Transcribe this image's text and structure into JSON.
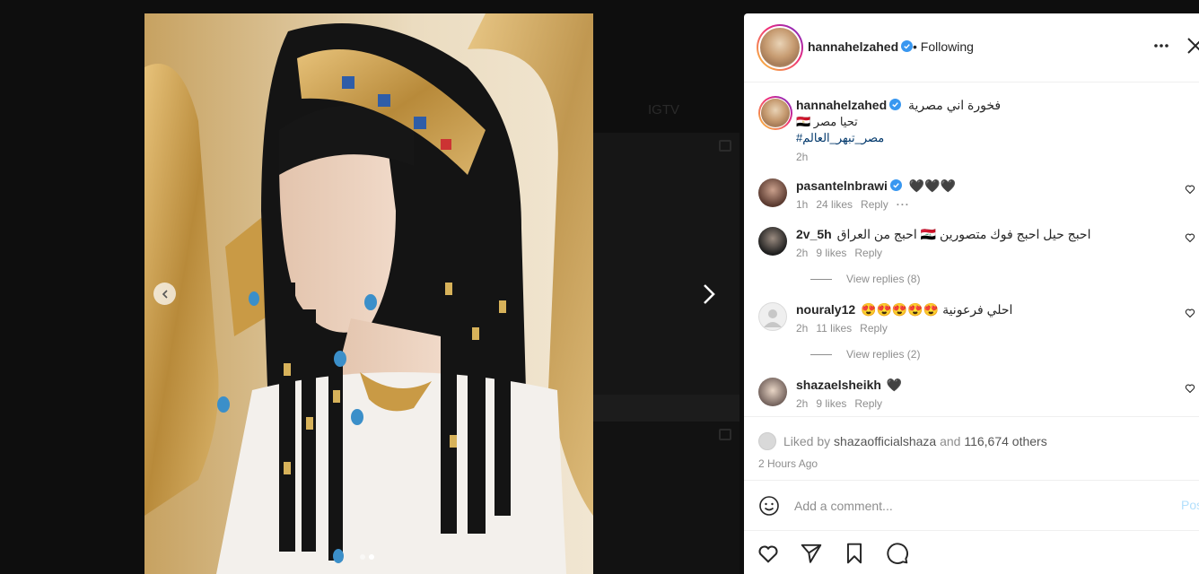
{
  "background": {
    "label": "IGTV"
  },
  "carousel": {
    "active_index": 1,
    "count": 2
  },
  "header": {
    "username": "hannahelzahed",
    "follow_status": "• Following"
  },
  "caption": {
    "username": "hannahelzahed",
    "text_line1": "فخورة اني مصرية",
    "text_line2": "تحيا مصر 🇪🇬",
    "hashtag": "#مصر_تبهر_العالم",
    "time": "2h"
  },
  "comments": [
    {
      "username": "pasantelnbrawi",
      "verified": true,
      "text": "🖤🖤🖤",
      "time": "1h",
      "likes": "24 likes",
      "reply": "Reply",
      "more": "···"
    },
    {
      "username": "2v_5h",
      "verified": false,
      "text": "احبج حيل احبج فوك متصورين 🇮🇶 احبج من العراق",
      "time": "2h",
      "likes": "9 likes",
      "reply": "Reply",
      "view_replies": "View replies (8)"
    },
    {
      "username": "nouraly12",
      "verified": false,
      "text": "احلي فرعونية 😍😍😍😍😍",
      "time": "2h",
      "likes": "11 likes",
      "reply": "Reply",
      "view_replies": "View replies (2)"
    },
    {
      "username": "shazaelsheikh",
      "verified": false,
      "text": "🖤",
      "time": "2h",
      "likes": "9 likes",
      "reply": "Reply"
    }
  ],
  "likes": {
    "prefix": "Liked by",
    "user": "shazaofficialshaza",
    "joiner": "and",
    "others": "116,674 others"
  },
  "time_ago": "2 Hours Ago",
  "add_comment": {
    "placeholder": "Add a comment...",
    "post_label": "Post"
  },
  "icons": [
    "like-heart-icon",
    "share-send-icon",
    "save-bookmark-icon",
    "comment-bubble-icon"
  ],
  "colors": {
    "verified": "#3897f0",
    "hashtag": "#00376b",
    "muted": "#8e8e8e",
    "post_disabled": "#b2dffc"
  }
}
